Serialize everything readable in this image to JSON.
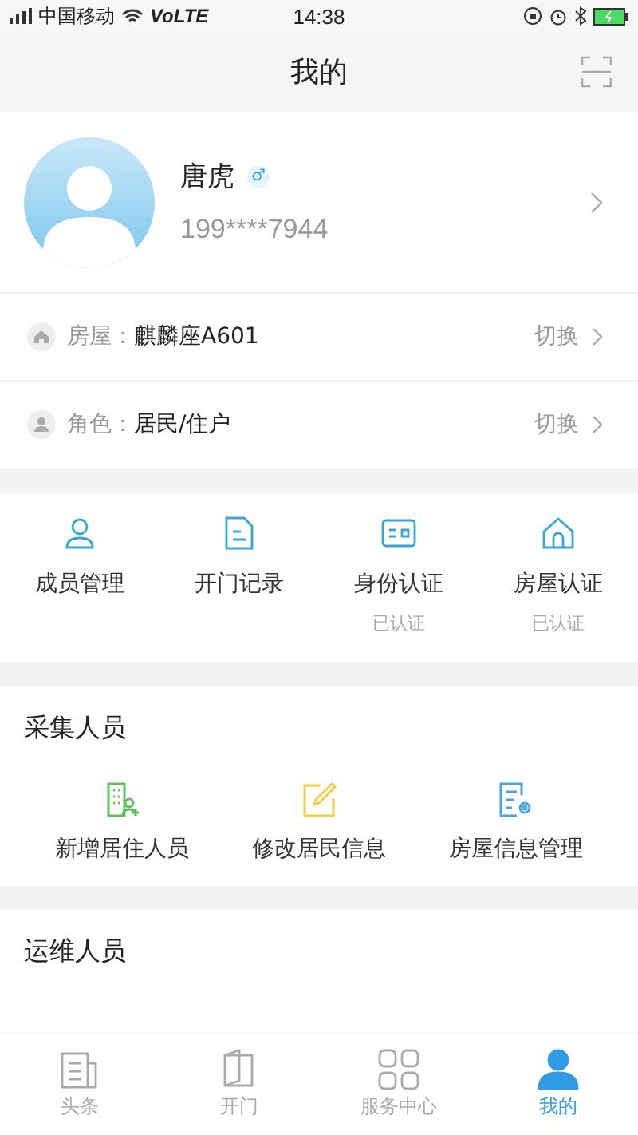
{
  "status_bar": {
    "carrier": "中国移动",
    "network": "VoLTE",
    "time": "14:38"
  },
  "header": {
    "title": "我的"
  },
  "profile": {
    "name": "唐虎",
    "gender": "♂",
    "phone": "199****7944"
  },
  "info_rows": [
    {
      "kind": "house",
      "label": "房屋：",
      "value": "麒麟座A601",
      "action": "切换"
    },
    {
      "kind": "person",
      "label": "角色：",
      "value": "居民/住户",
      "action": "切换"
    }
  ],
  "quick_actions": [
    {
      "kind": "person",
      "label": "成员管理"
    },
    {
      "kind": "doc",
      "label": "开门记录"
    },
    {
      "kind": "id",
      "label": "身份认证",
      "status": "已认证"
    },
    {
      "kind": "house",
      "label": "房屋认证",
      "status": "已认证"
    }
  ],
  "sections": [
    {
      "title": "采集人员",
      "items": [
        {
          "kind": "building-add",
          "label": "新增居住人员"
        },
        {
          "kind": "edit",
          "label": "修改居民信息"
        },
        {
          "kind": "doc-gear",
          "label": "房屋信息管理"
        }
      ]
    },
    {
      "title": "运维人员"
    }
  ],
  "tabs": [
    {
      "kind": "news",
      "label": "头条",
      "selected": false
    },
    {
      "kind": "door",
      "label": "开门",
      "selected": false
    },
    {
      "kind": "grid",
      "label": "服务中心",
      "selected": false
    },
    {
      "kind": "person",
      "label": "我的",
      "selected": true
    }
  ]
}
